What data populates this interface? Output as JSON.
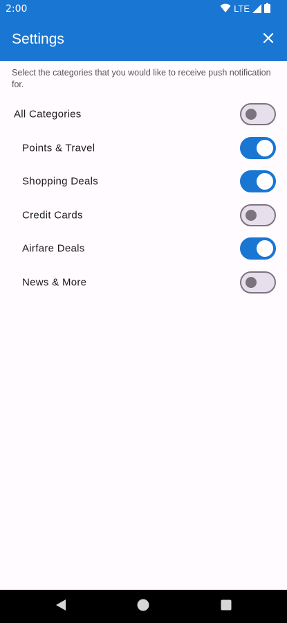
{
  "status_bar": {
    "time": "2:00",
    "network": "LTE",
    "icons": [
      "wifi-icon",
      "signal-icon",
      "battery-icon"
    ]
  },
  "app_bar": {
    "title": "Settings",
    "close_icon": "close-icon"
  },
  "description": "Select the categories that you would like to receive push notification for.",
  "categories": [
    {
      "label": "All Categories",
      "enabled": false
    },
    {
      "label": "Points & Travel",
      "enabled": true
    },
    {
      "label": "Shopping Deals",
      "enabled": true
    },
    {
      "label": "Credit Cards",
      "enabled": false
    },
    {
      "label": "Airfare Deals",
      "enabled": true
    },
    {
      "label": "News & More",
      "enabled": false
    }
  ],
  "nav_bar": {
    "icons": [
      "back-icon",
      "home-icon",
      "recents-icon"
    ]
  },
  "colors": {
    "primary": "#1976d2",
    "toggle_off_track": "#e7e0ec",
    "toggle_off_outline": "#79747e",
    "background": "#fffbff"
  }
}
